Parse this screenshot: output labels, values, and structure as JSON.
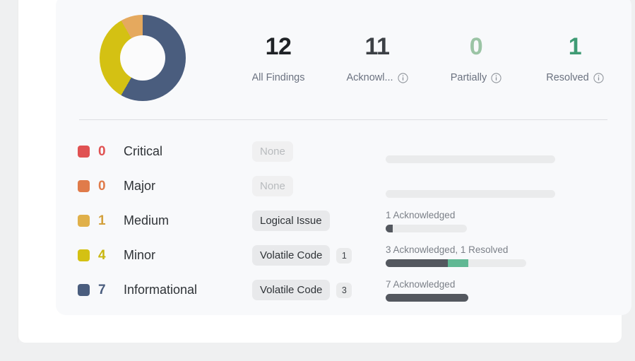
{
  "colors": {
    "critical": "#e05252",
    "major": "#e07b4a",
    "medium": "#e0b04a",
    "minor": "#d4c113",
    "informational": "#4a5d7e",
    "acknowledged_bar": "#54585f",
    "resolved_bar": "#61b894",
    "track": "#eaebec",
    "partially_text": "#9bc4a5",
    "resolved_text": "#3f9b74"
  },
  "summary": {
    "stats": [
      {
        "value": "12",
        "label": "All Findings",
        "has_info": false,
        "value_color": "#1f2226"
      },
      {
        "value": "11",
        "label": "Acknowl...",
        "has_info": true,
        "value_color": "#3c4045"
      },
      {
        "value": "0",
        "label": "Partially",
        "has_info": true,
        "value_color": "#9bc4a5"
      },
      {
        "value": "1",
        "label": "Resolved",
        "has_info": true,
        "value_color": "#3f9b74"
      }
    ],
    "donut": {
      "segments": [
        {
          "name": "Informational",
          "value": 7,
          "color": "#4a5d7e"
        },
        {
          "name": "Minor",
          "value": 4,
          "color": "#d4c113"
        },
        {
          "name": "Medium",
          "value": 1,
          "color": "#e5a95e"
        }
      ],
      "total": 12
    },
    "rows": [
      {
        "severity": "Critical",
        "count": "0",
        "color": "#e05252",
        "count_color": "#e05252",
        "tag": "None",
        "tag_muted": true,
        "tag_badge": "",
        "progress_label": "",
        "track_width": 240,
        "acknowledged_pct": 0,
        "resolved_pct": 0
      },
      {
        "severity": "Major",
        "count": "0",
        "color": "#e07b4a",
        "count_color": "#e07b4a",
        "tag": "None",
        "tag_muted": true,
        "tag_badge": "",
        "progress_label": "",
        "track_width": 240,
        "acknowledged_pct": 0,
        "resolved_pct": 0
      },
      {
        "severity": "Medium",
        "count": "1",
        "color": "#e0b04a",
        "count_color": "#d3a03c",
        "tag": "Logical Issue",
        "tag_muted": false,
        "tag_badge": "",
        "progress_label": "1 Acknowledged",
        "track_width": 115,
        "acknowledged_pct": 9,
        "resolved_pct": 0
      },
      {
        "severity": "Minor",
        "count": "4",
        "color": "#d4c113",
        "count_color": "#c9b70f",
        "tag": "Volatile Code",
        "tag_muted": false,
        "tag_badge": "1",
        "progress_label": "3 Acknowledged, 1 Resolved",
        "track_width": 199,
        "acknowledged_pct": 44,
        "resolved_pct": 15
      },
      {
        "severity": "Informational",
        "count": "7",
        "color": "#4a5d7e",
        "count_color": "#4a5d7e",
        "tag": "Volatile Code",
        "tag_muted": false,
        "tag_badge": "3",
        "progress_label": "7 Acknowledged",
        "track_width": 117,
        "acknowledged_pct": 100,
        "resolved_pct": 0
      }
    ]
  },
  "icons": {
    "info": "info-circle-icon"
  }
}
